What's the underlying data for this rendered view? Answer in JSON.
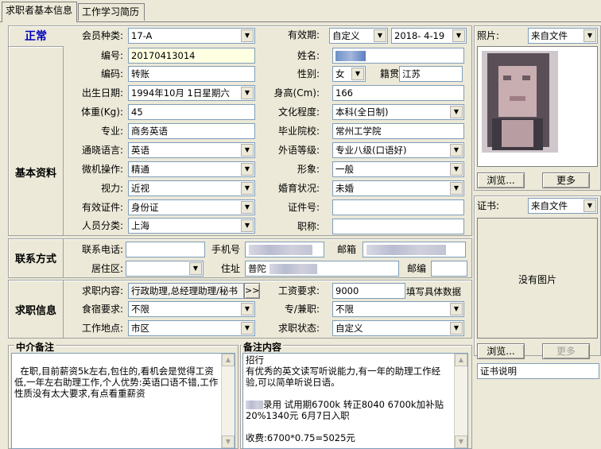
{
  "tabs": [
    "求职者基本信息",
    "工作学习简历"
  ],
  "status": "正常",
  "sections": {
    "basic": "基本资料",
    "contact": "联系方式",
    "job": "求职信息"
  },
  "fields": {
    "member_type": {
      "label": "会员种类:",
      "value": "17-A"
    },
    "validity": {
      "label": "有效期:",
      "value": "自定义",
      "date": "2018- 4-19"
    },
    "number": {
      "label": "编号:",
      "value": "20170413014"
    },
    "name": {
      "label": "姓名:",
      "value": ""
    },
    "code": {
      "label": "编码:",
      "value": "转账"
    },
    "gender": {
      "label": "性别:",
      "value": "女"
    },
    "native": {
      "label": "籍贯",
      "value": "江苏"
    },
    "birth": {
      "label": "出生日期:",
      "value": "1994年10月 1日星期六"
    },
    "height": {
      "label": "身高(Cm):",
      "value": "166"
    },
    "weight": {
      "label": "体重(Kg):",
      "value": "45"
    },
    "education": {
      "label": "文化程度:",
      "value": "本科(全日制)"
    },
    "major": {
      "label": "专业:",
      "value": "商务英语"
    },
    "school": {
      "label": "毕业院校:",
      "value": "常州工学院"
    },
    "language": {
      "label": "通晓语言:",
      "value": "英语"
    },
    "foreign_level": {
      "label": "外语等级:",
      "value": "专业八级(口语好)"
    },
    "computer": {
      "label": "微机操作:",
      "value": "精通"
    },
    "image": {
      "label": "形象:",
      "value": "一般"
    },
    "vision": {
      "label": "视力:",
      "value": "近视"
    },
    "marital": {
      "label": "婚育状况:",
      "value": "未婚"
    },
    "id_type": {
      "label": "有效证件:",
      "value": "身份证"
    },
    "id_number": {
      "label": "证件号:",
      "value": ""
    },
    "person_type": {
      "label": "人员分类:",
      "value": "上海"
    },
    "title": {
      "label": "职称:",
      "value": ""
    },
    "phone": {
      "label": "联系电话:",
      "value": ""
    },
    "mobile": {
      "label": "手机号",
      "value": ""
    },
    "email": {
      "label": "邮箱",
      "value": ""
    },
    "district": {
      "label": "居住区:",
      "value": ""
    },
    "address": {
      "label": "住址",
      "value": "普陀"
    },
    "postcode": {
      "label": "邮编",
      "value": ""
    },
    "job_content": {
      "label": "求职内容:",
      "value": "行政助理,总经理助理/秘书"
    },
    "salary": {
      "label": "工资要求:",
      "value": "9000",
      "hint": "填写具体数据"
    },
    "lodging": {
      "label": "食宿要求:",
      "value": "不限"
    },
    "fulltime": {
      "label": "专/兼职:",
      "value": "不限"
    },
    "location": {
      "label": "工作地点:",
      "value": "市区"
    },
    "job_status": {
      "label": "求职状态:",
      "value": "自定义"
    }
  },
  "expand_button": ">>",
  "memo_agent": {
    "title": "中介备注",
    "text": "在职,目前薪资5k左右,包住的,看机会是觉得工资低,一年左右助理工作,个人优势:英语口语不错,工作性质没有太大要求,有点看重薪资"
  },
  "memo_remarks": {
    "title": "备注内容",
    "lines": [
      "招行",
      "有优秀的英文读写听说能力,有一年的助理工作经验,可以简单听说日语。",
      "",
      "录用 试用期6700k  转正8040 6700k加补贴20%1340元 6月7日入职",
      "",
      "收费:6700*0.75=5025元"
    ]
  },
  "photo_panel": {
    "label": "照片:",
    "source": "来自文件",
    "browse": "浏览...",
    "more": "更多"
  },
  "cert_panel": {
    "label": "证书:",
    "source": "来自文件",
    "empty": "没有图片",
    "browse": "浏览...",
    "more": "更多",
    "desc": "证书说明"
  }
}
